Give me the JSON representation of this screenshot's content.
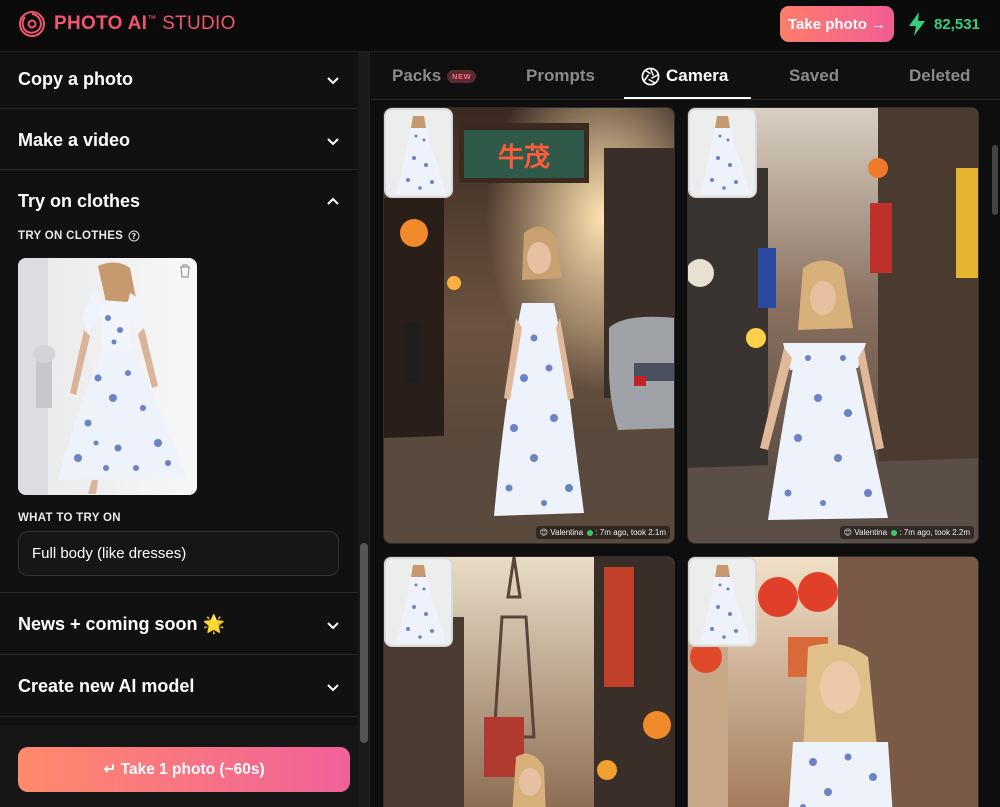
{
  "header": {
    "brand_bold": "PHOTO AI",
    "brand_tm": "™",
    "brand_light": " STUDIO",
    "take_photo_label": "Take photo →",
    "credits": "82,531",
    "icons": {
      "logo": "aperture-logo",
      "credits": "lightning-icon"
    }
  },
  "sidebar": {
    "sections": [
      {
        "title": "Copy a photo",
        "expanded": false
      },
      {
        "title": "Make a video",
        "expanded": false
      },
      {
        "title": "Try on clothes",
        "expanded": true
      },
      {
        "title": "News + coming soon 🌟",
        "expanded": false
      },
      {
        "title": "Create new AI model",
        "expanded": false
      }
    ],
    "try_on": {
      "label": "TRY ON CLOTHES",
      "what_label": "WHAT TO TRY ON",
      "what_value": "Full body (like dresses)"
    },
    "cta_label": "↵ Take 1 photo (~60s)"
  },
  "tabs": [
    {
      "label": "Packs",
      "badge": "NEW",
      "active": false
    },
    {
      "label": "Prompts",
      "active": false
    },
    {
      "label": "Camera",
      "active": true
    },
    {
      "label": "Saved",
      "active": false
    },
    {
      "label": "Deleted",
      "active": false
    }
  ],
  "photos": [
    {
      "caption_name": "Valentina",
      "caption_time": ": 7m ago, took 2.1m"
    },
    {
      "caption_name": "Valentina",
      "caption_time": ": 7m ago, took 2.2m"
    },
    {
      "caption_name": "",
      "caption_time": ""
    },
    {
      "caption_name": "",
      "caption_time": ""
    }
  ],
  "colors": {
    "brand": "#f0566f",
    "credits": "#35d07f",
    "cta_start": "#ff8a6b",
    "cta_end": "#f0609a"
  }
}
